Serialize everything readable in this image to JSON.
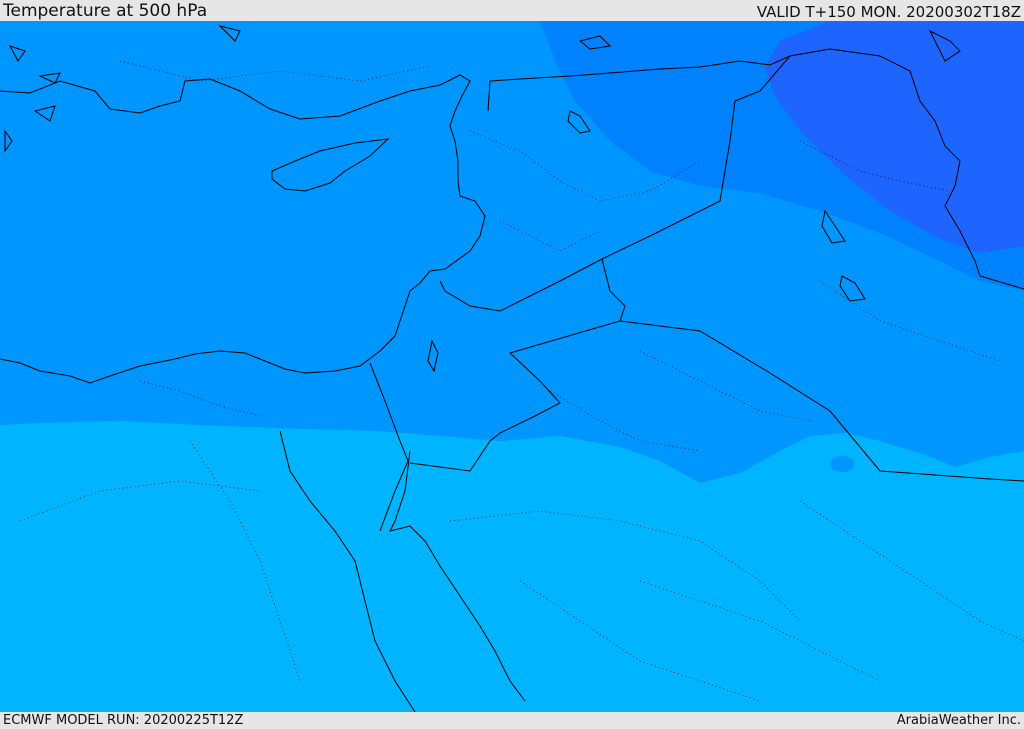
{
  "header": {
    "title": "Temperature at 500 hPa",
    "valid": "VALID T+150 MON. 20200302T18Z"
  },
  "footer": {
    "model_run": "ECMWF MODEL RUN: 20200225T12Z",
    "credit": "ArabiaWeather Inc."
  },
  "map": {
    "colors": {
      "warmest": "#00b4ff",
      "mid": "#0096ff",
      "cool": "#0082ff",
      "coldest": "#1e64ff",
      "coast": "#000000"
    }
  }
}
